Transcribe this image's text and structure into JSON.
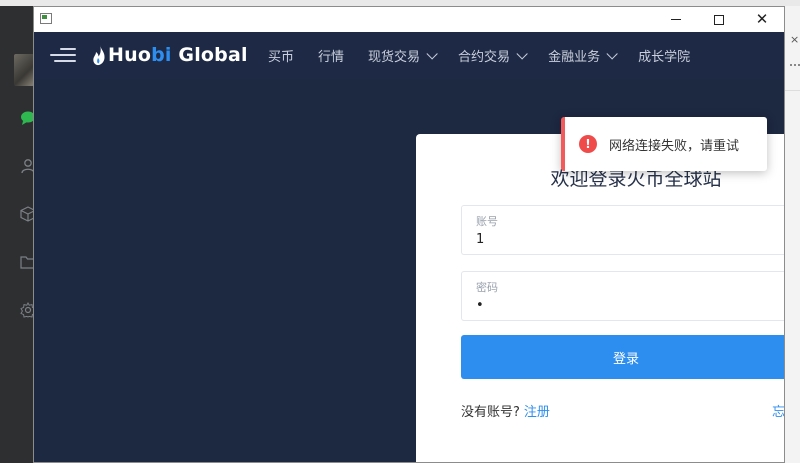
{
  "window": {
    "controls": {
      "minimize": "minimize",
      "maximize": "maximize",
      "close": "✕"
    }
  },
  "navbar": {
    "logo": {
      "text_main_1": "Huo",
      "text_accent": "bi",
      "text_main_2": " Global"
    },
    "items": [
      {
        "label": "买币",
        "dropdown": false
      },
      {
        "label": "行情",
        "dropdown": false
      },
      {
        "label": "现货交易",
        "dropdown": true
      },
      {
        "label": "合约交易",
        "dropdown": true
      },
      {
        "label": "金融业务",
        "dropdown": true
      },
      {
        "label": "成长学院",
        "dropdown": false
      }
    ]
  },
  "login": {
    "title": "欢迎登录火币全球站",
    "account": {
      "label": "账号",
      "value": "1"
    },
    "password": {
      "label": "密码",
      "value": "•"
    },
    "submit_label": "登录",
    "no_account_text": "没有账号?",
    "register_label": "注册",
    "forgot_label": "忘"
  },
  "toast": {
    "icon": "error-icon",
    "message": "网络连接失败，请重试"
  },
  "colors": {
    "nav_bg": "#1e2a45",
    "page_bg": "#1d2841",
    "accent": "#2e8ef0",
    "error": "#ef4b4b"
  }
}
